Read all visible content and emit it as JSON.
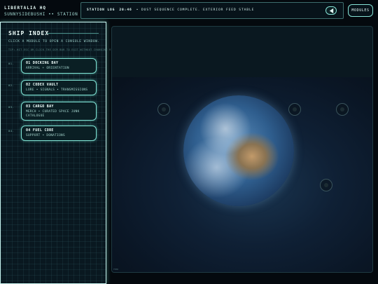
{
  "header": {
    "brand_line1": "LIBERTALIA HQ",
    "brand_line2": "SUNNYSIDEBUSHI •• STATION ONLINE",
    "status_label": "STATION LOG",
    "status_time": "20:46",
    "status_message": "• DUST SEQUENCE COMPLETE. EXTERIOR FEED STABLE",
    "modules_button": "MODULES"
  },
  "sidebar": {
    "title": "SHIP INDEX",
    "subtitle": "CLICK A MODULE TO OPEN A CONSOLE WINDOW.",
    "hint": "TIP: HIT ESC OR CLICK THE DIM BAR TO EXIT WITHOUT CHANGING VIEW.",
    "modules": [
      {
        "num": "01.",
        "title": "01 DOCKING BAY",
        "desc": "ARRIVAL + ORIENTATION"
      },
      {
        "num": "02.",
        "title": "02 CODEX VAULT",
        "desc": "LORE • SIGNALS • TRANSMISSIONS"
      },
      {
        "num": "03.",
        "title": "03 CARGO BAY",
        "desc": "MERCH • CURATED SPACE JUNK CATALOGUE"
      },
      {
        "num": "04.",
        "title": "04 FUEL CORE",
        "desc": "SUPPORT • DONATIONS"
      }
    ]
  },
  "viewport": {
    "corner_label": "FEED"
  },
  "icons": {
    "play": "play-left-icon",
    "hotspot": "hotspot-ring-icon"
  },
  "colors": {
    "accent": "#7fe2d4",
    "background": "#04090e",
    "panel": "#091820"
  }
}
